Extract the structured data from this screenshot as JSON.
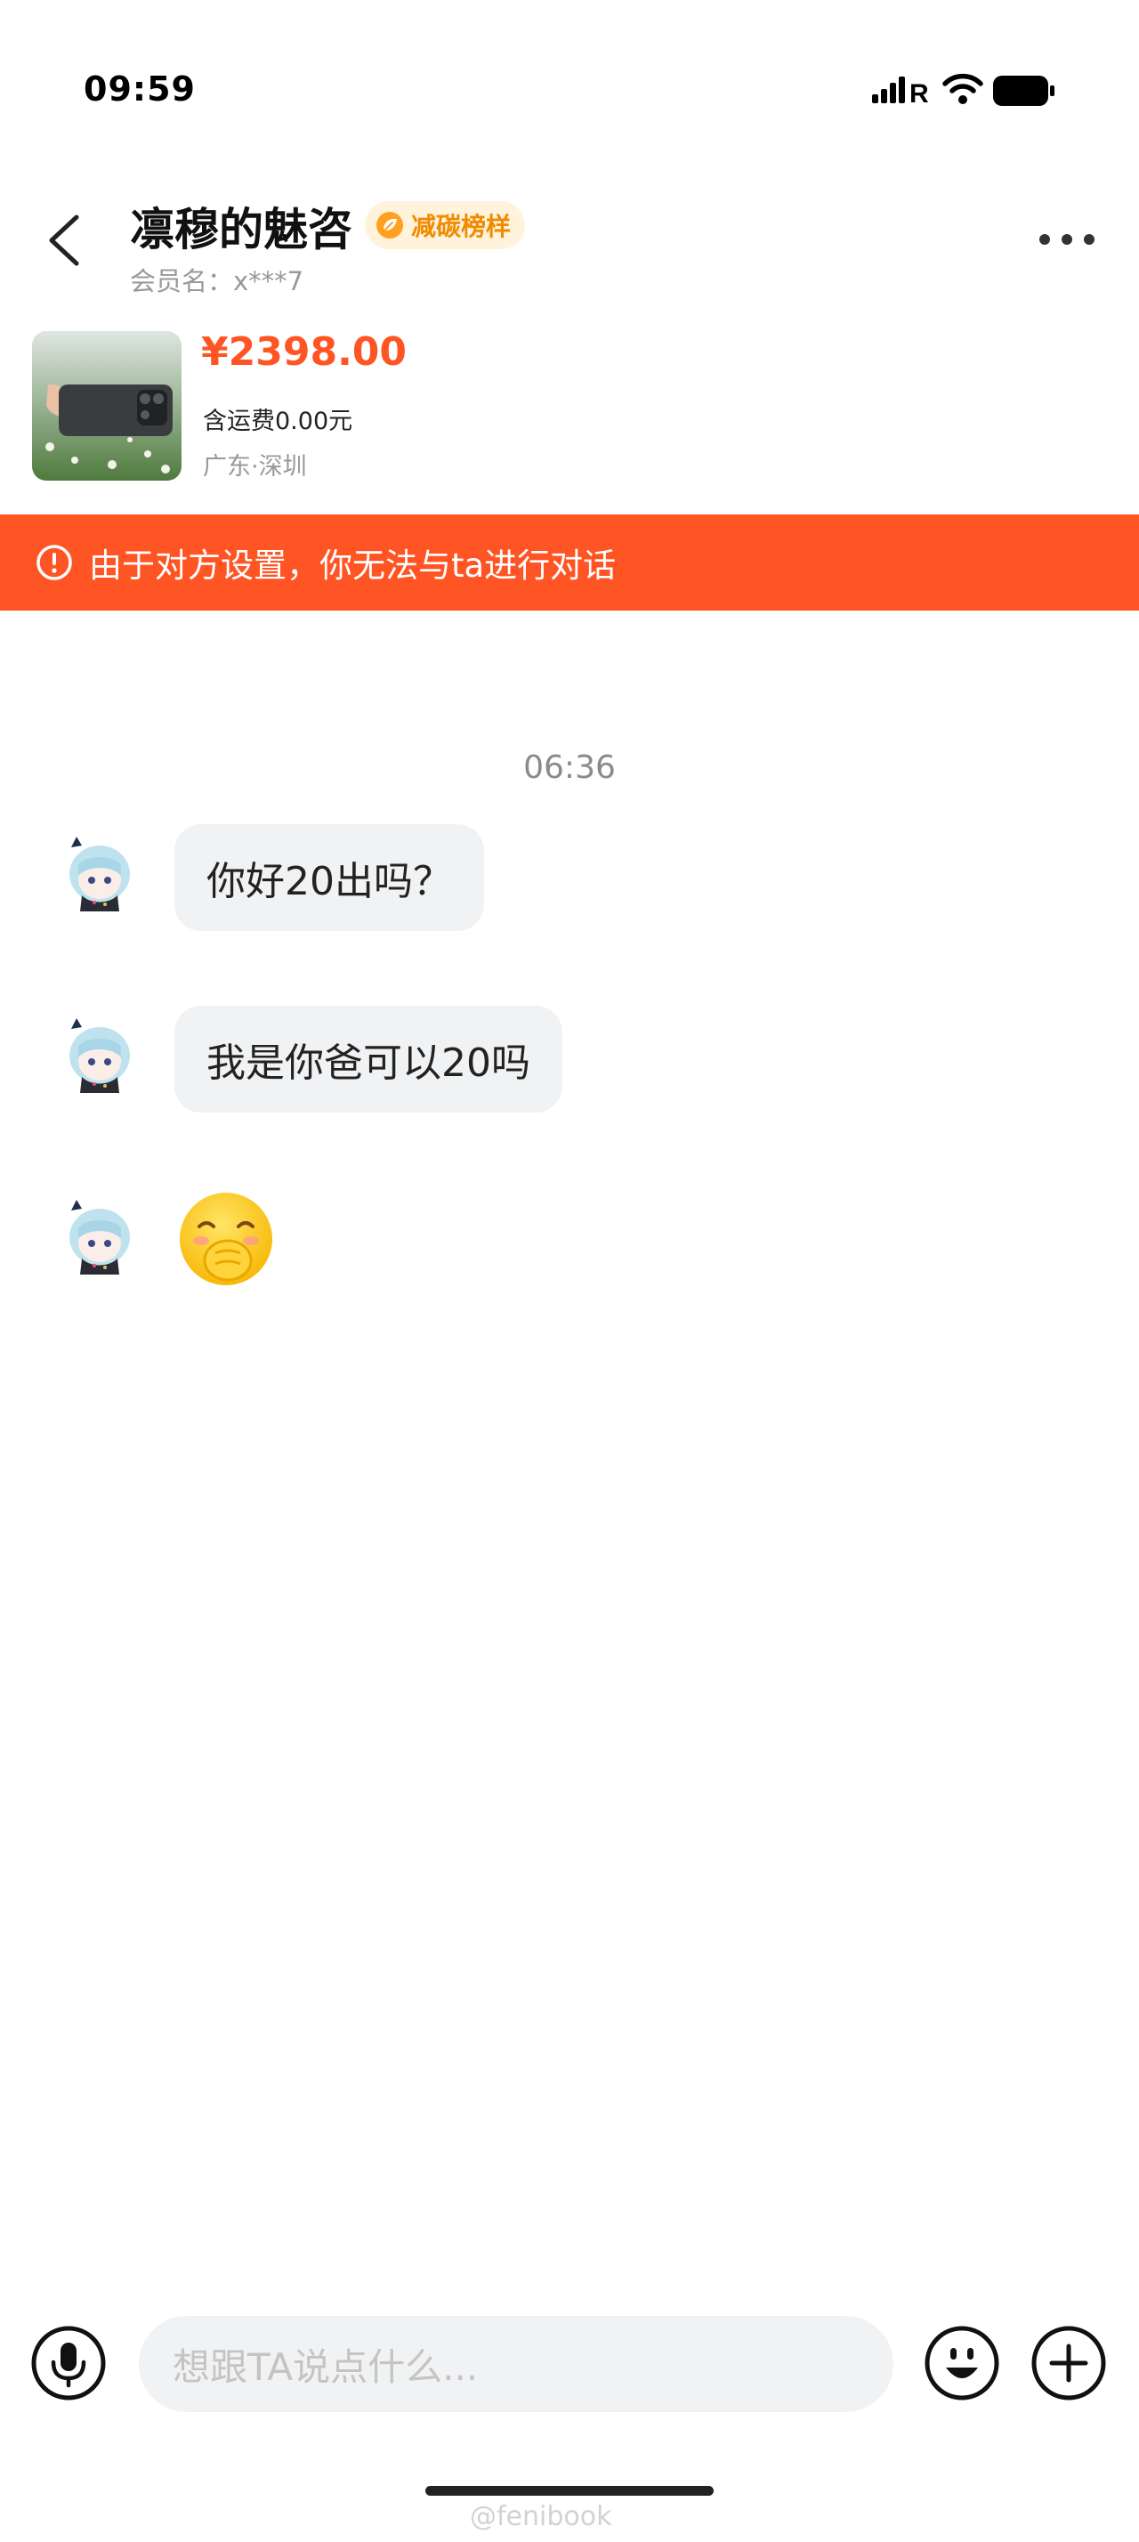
{
  "status_bar": {
    "time": "09:59",
    "carrier_mark": "R"
  },
  "header": {
    "back_icon": "chevron-left-icon",
    "title": "凛穆的魅咨",
    "badge_label": "减碳榜样",
    "member_label": "会员名：x***7",
    "more_icon": "more-dots-icon"
  },
  "product": {
    "price": "¥2398.00",
    "shipping": "含运费0.00元",
    "location": "广东·深圳"
  },
  "warning": {
    "icon": "alert-circle-icon",
    "text": "由于对方设置，你无法与ta进行对话"
  },
  "chat": {
    "timestamp": "06:36",
    "messages": [
      {
        "type": "text",
        "text": "你好20出吗？"
      },
      {
        "type": "text",
        "text": "我是你爸可以20吗"
      },
      {
        "type": "emoji",
        "icon": "covering-mouth-emoji"
      }
    ]
  },
  "input_bar": {
    "voice_icon": "microphone-icon",
    "placeholder": "想跟TA说点什么...",
    "emoji_icon": "smiley-icon",
    "add_icon": "plus-circle-icon"
  },
  "watermark": "@fenibook",
  "colors": {
    "accent": "#ff5524",
    "badge_text": "#f08a00",
    "badge_bg": "#fff3dc",
    "bubble_bg": "#f1f2f4"
  }
}
